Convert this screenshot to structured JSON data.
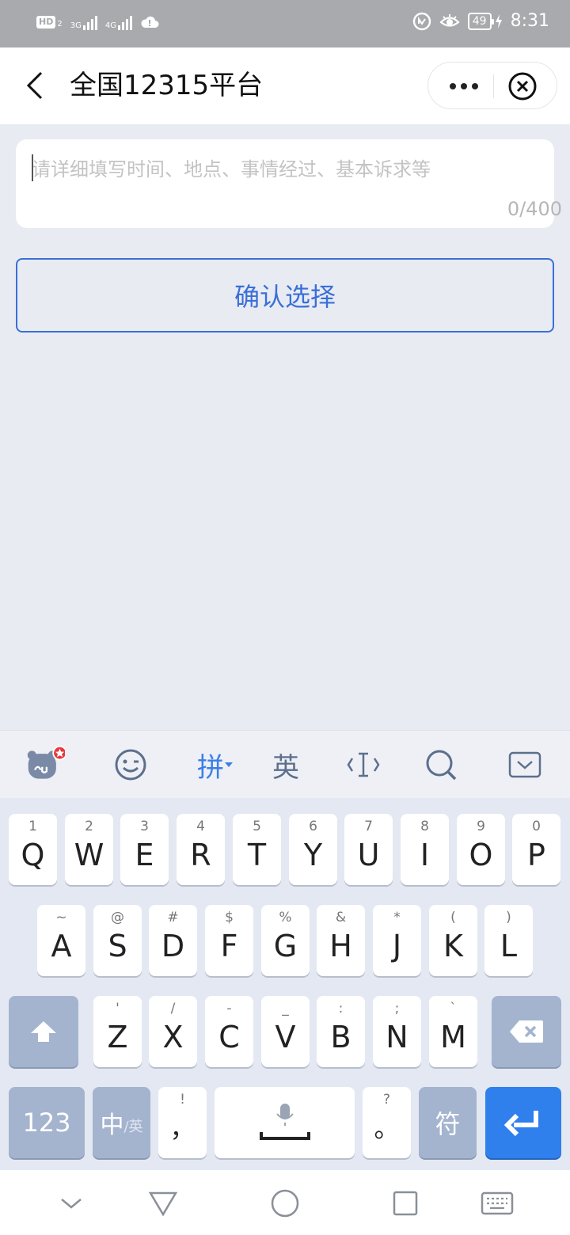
{
  "status_bar": {
    "hd_badge": "HD",
    "sim_badge": "2",
    "net_1": "3G",
    "net_2": "4G",
    "battery": "49",
    "time": "8:31"
  },
  "header": {
    "title": "全国12315平台"
  },
  "complaint": {
    "placeholder": "请详细填写时间、地点、事情经过、基本诉求等",
    "value": "",
    "counter": "0/400"
  },
  "confirm_button": {
    "label": "确认选择"
  },
  "keyboard": {
    "toolbar": {
      "pinyin_label": "拼",
      "english_label": "英"
    },
    "row1": [
      {
        "sub": "1",
        "main": "Q"
      },
      {
        "sub": "2",
        "main": "W"
      },
      {
        "sub": "3",
        "main": "E"
      },
      {
        "sub": "4",
        "main": "R"
      },
      {
        "sub": "5",
        "main": "T"
      },
      {
        "sub": "6",
        "main": "Y"
      },
      {
        "sub": "7",
        "main": "U"
      },
      {
        "sub": "8",
        "main": "I"
      },
      {
        "sub": "9",
        "main": "O"
      },
      {
        "sub": "0",
        "main": "P"
      }
    ],
    "row2": [
      {
        "sub": "~",
        "main": "A"
      },
      {
        "sub": "@",
        "main": "S"
      },
      {
        "sub": "#",
        "main": "D"
      },
      {
        "sub": "$",
        "main": "F"
      },
      {
        "sub": "%",
        "main": "G"
      },
      {
        "sub": "&",
        "main": "H"
      },
      {
        "sub": "*",
        "main": "J"
      },
      {
        "sub": "(",
        "main": "K"
      },
      {
        "sub": ")",
        "main": "L"
      }
    ],
    "row3": [
      {
        "sub": "'",
        "main": "Z"
      },
      {
        "sub": "/",
        "main": "X"
      },
      {
        "sub": "-",
        "main": "C"
      },
      {
        "sub": "_",
        "main": "V"
      },
      {
        "sub": ":",
        "main": "B"
      },
      {
        "sub": ";",
        "main": "N"
      },
      {
        "sub": "`",
        "main": "M"
      }
    ],
    "row4": {
      "numbers": "123",
      "lang_main": "中",
      "lang_sub": "/英",
      "comma_sub": "!",
      "comma_main": "，",
      "period_sub": "?",
      "period_main": "。",
      "symbols": "符"
    }
  },
  "colors": {
    "accent": "#3a6fd8",
    "enter_key": "#2f80ed",
    "dark_key": "#a4b4cf",
    "background": "#e8ebf2"
  }
}
